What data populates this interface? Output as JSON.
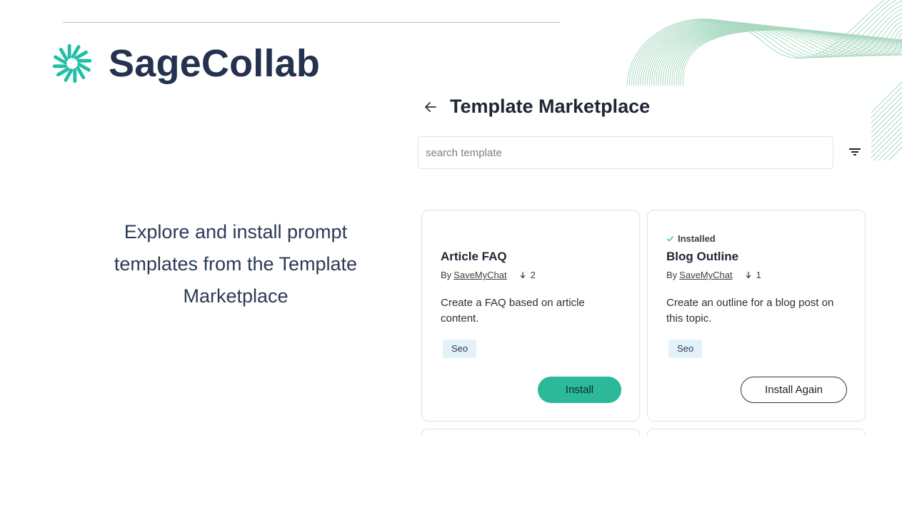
{
  "brand": {
    "name": "SageCollab",
    "logo_icon": "sunburst-logo-icon",
    "accent": "#1fbfa4"
  },
  "tagline": "Explore and install prompt templates from the Template Marketplace",
  "marketplace": {
    "title": "Template Marketplace",
    "back_icon": "arrow-left-icon",
    "filter_icon": "filter-icon",
    "search": {
      "placeholder": "search template",
      "value": ""
    },
    "cards": [
      {
        "installed_label": "",
        "title": "Article FAQ",
        "by_label": "By",
        "author": "SaveMyChat",
        "downloads": "2",
        "description": "Create a FAQ based on article content.",
        "tag": "Seo",
        "action_label": "Install"
      },
      {
        "installed_label": "Installed",
        "title": "Blog Outline",
        "by_label": "By",
        "author": "SaveMyChat",
        "downloads": "1",
        "description": "Create an outline for a blog post on this topic.",
        "tag": "Seo",
        "action_label": "Install Again"
      }
    ]
  },
  "colors": {
    "install_button": "#2bb99a",
    "tag_background": "#e3f1fb",
    "heading": "#24314f",
    "decor_lines": "#a8d9c0"
  }
}
